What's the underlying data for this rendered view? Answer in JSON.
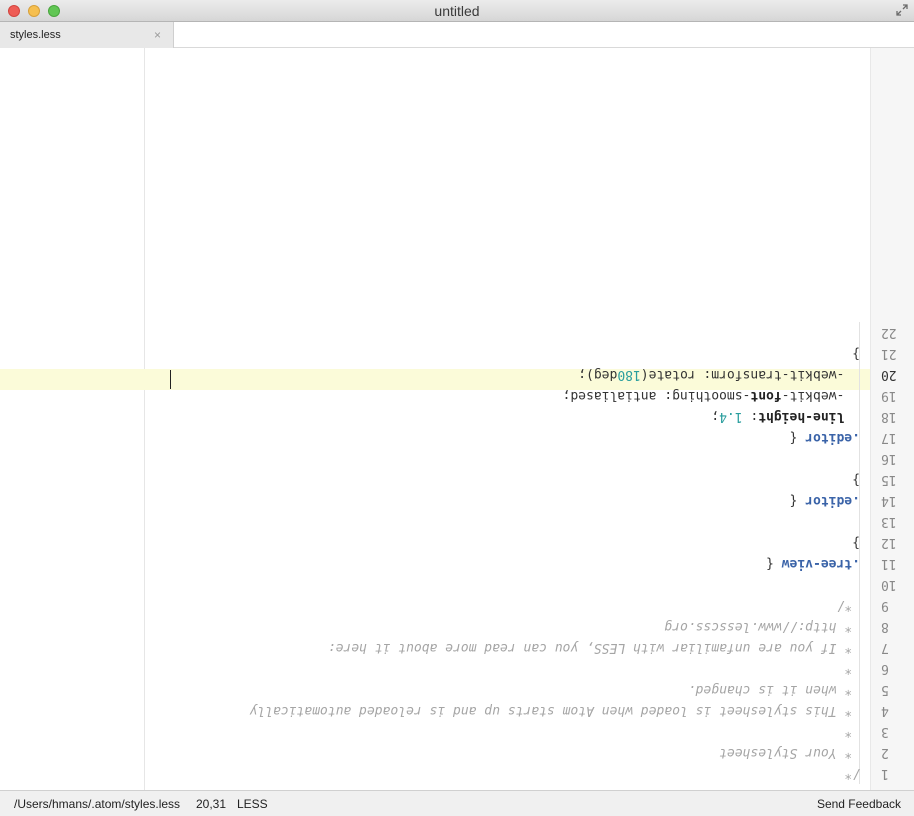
{
  "window": {
    "title": "untitled"
  },
  "tabs": [
    {
      "label": "styles.less",
      "close_glyph": "×"
    }
  ],
  "editor": {
    "active_line": 20,
    "lines": [
      {
        "n": "1",
        "segments": [
          {
            "t": "/*",
            "c": "cm"
          }
        ]
      },
      {
        "n": "2",
        "segments": [
          {
            "t": " * Your Stylesheet",
            "c": "cm"
          }
        ]
      },
      {
        "n": "3",
        "segments": [
          {
            "t": " *",
            "c": "cm"
          }
        ]
      },
      {
        "n": "4",
        "segments": [
          {
            "t": " * This stylesheet is loaded when Atom starts up and is reloaded automatically",
            "c": "cm"
          }
        ]
      },
      {
        "n": "5",
        "segments": [
          {
            "t": " * when it is changed.",
            "c": "cm"
          }
        ]
      },
      {
        "n": "6",
        "segments": [
          {
            "t": " *",
            "c": "cm"
          }
        ]
      },
      {
        "n": "7",
        "segments": [
          {
            "t": " * If you are unfamiliar with LESS, you can read more about it here:",
            "c": "cm"
          }
        ]
      },
      {
        "n": "8",
        "segments": [
          {
            "t": " * http://www.lesscss.org",
            "c": "cm"
          }
        ]
      },
      {
        "n": "9",
        "segments": [
          {
            "t": " */",
            "c": "cm"
          }
        ]
      },
      {
        "n": "10",
        "segments": []
      },
      {
        "n": "11",
        "segments": [
          {
            "t": ".tree-view",
            "c": "sel"
          },
          {
            "t": " {",
            "c": ""
          }
        ]
      },
      {
        "n": "12",
        "segments": [
          {
            "t": "}",
            "c": ""
          }
        ]
      },
      {
        "n": "13",
        "segments": []
      },
      {
        "n": "14",
        "segments": [
          {
            "t": ".editor",
            "c": "sel"
          },
          {
            "t": " {",
            "c": ""
          }
        ]
      },
      {
        "n": "15",
        "segments": [
          {
            "t": "}",
            "c": ""
          }
        ]
      },
      {
        "n": "16",
        "segments": []
      },
      {
        "n": "17",
        "segments": [
          {
            "t": ".editor",
            "c": "sel"
          },
          {
            "t": " {",
            "c": ""
          }
        ]
      },
      {
        "n": "18",
        "segments": [
          {
            "t": "  ",
            "c": ""
          },
          {
            "t": "line-height",
            "c": "prop"
          },
          {
            "t": ": ",
            "c": ""
          },
          {
            "t": "1.4",
            "c": "num"
          },
          {
            "t": ";",
            "c": ""
          }
        ]
      },
      {
        "n": "19",
        "segments": [
          {
            "t": "  -webkit-",
            "c": ""
          },
          {
            "t": "font",
            "c": "prop"
          },
          {
            "t": "-smoothing: antialiased;",
            "c": ""
          }
        ]
      },
      {
        "n": "20",
        "segments": [
          {
            "t": "  -webkit-transform: rotate(",
            "c": ""
          },
          {
            "t": "180",
            "c": "num"
          },
          {
            "t": "deg);",
            "c": ""
          }
        ]
      },
      {
        "n": "21",
        "segments": [
          {
            "t": "}",
            "c": ""
          }
        ]
      },
      {
        "n": "22",
        "segments": []
      }
    ]
  },
  "status": {
    "path": "/Users/hmans/.atom/styles.less",
    "cursor_pos": "20,31",
    "grammar": "LESS",
    "feedback": "Send Feedback"
  }
}
